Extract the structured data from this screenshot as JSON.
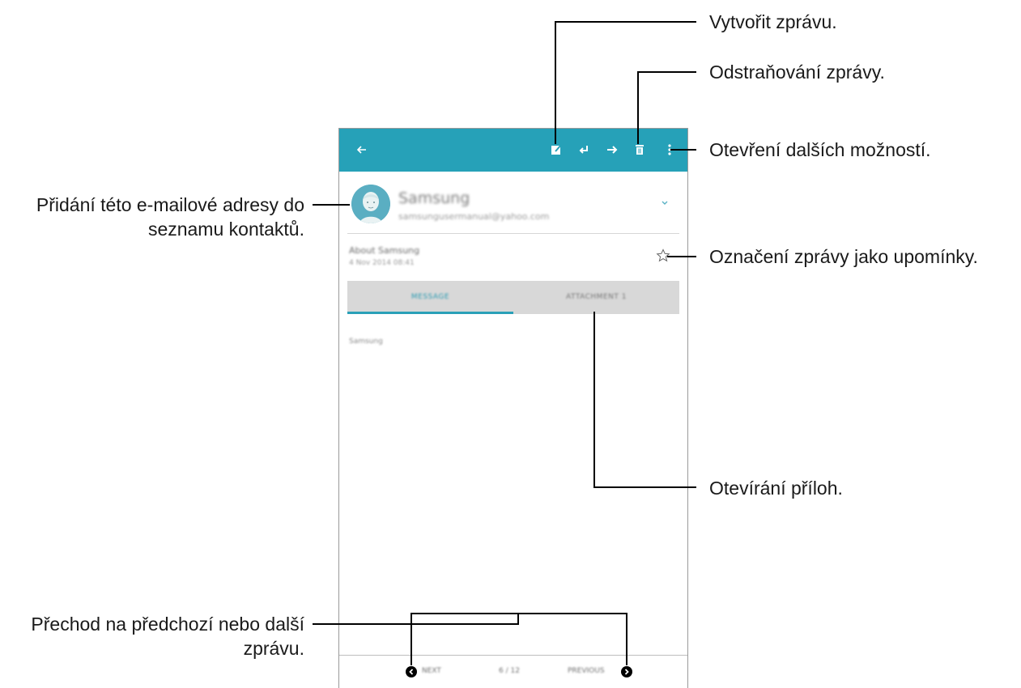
{
  "appbar": {
    "color": "#26a1b8",
    "icons": [
      "back-arrow-icon",
      "compose-icon",
      "reply-icon",
      "forward-icon",
      "delete-icon",
      "more-options-icon"
    ]
  },
  "message": {
    "sender_name": "Samsung",
    "sender_email": "samsungusermanual@yahoo.com",
    "subject": "About Samsung",
    "date": "4 Nov 2014 08:41",
    "body": "Samsung"
  },
  "tabs": {
    "message": "MESSAGE",
    "attachment": "ATTACHMENT 1"
  },
  "navigation": {
    "next": "NEXT",
    "count": "6 / 12",
    "previous": "PREVIOUS"
  },
  "callouts": {
    "compose": "Vytvořit zprávu.",
    "delete": "Odstraňování zprávy.",
    "more_options": "Otevření dalších možností.",
    "add_contact_line1": "Přidání této e-mailové adresy do",
    "add_contact_line2": "seznamu kontaktů.",
    "favorite": "Označení zprávy jako upomínky.",
    "attachments": "Otevírání příloh.",
    "navigate_line1": "Přechod na předchozí nebo další",
    "navigate_line2": "zprávu."
  }
}
